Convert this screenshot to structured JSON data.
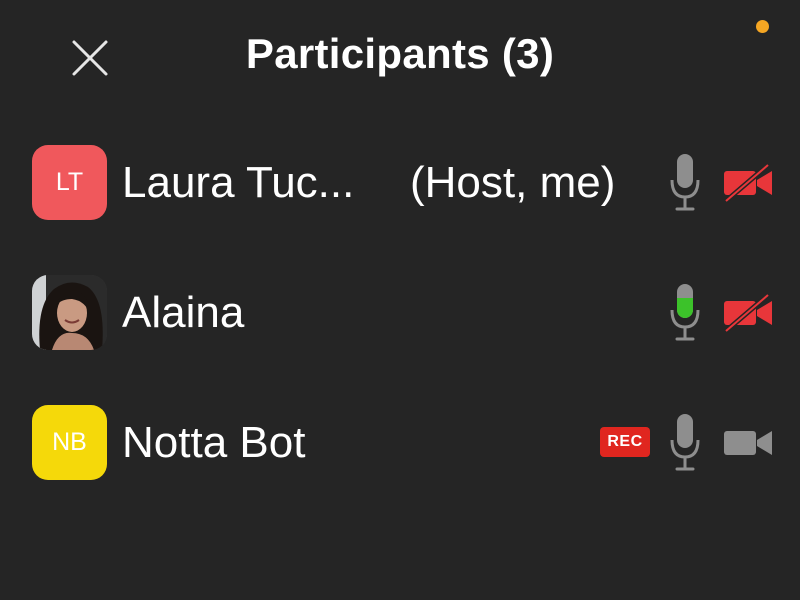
{
  "header": {
    "title": "Participants (3)",
    "close_icon": "close-icon",
    "status_dot_color": "#f5a623"
  },
  "colors": {
    "background": "#252525",
    "icon_gray": "#8e8e8e",
    "muted_red": "#e8363a",
    "speaking_green": "#3cc22a"
  },
  "participants": [
    {
      "initials": "LT",
      "name": "Laura Tuc...",
      "role": "(Host, me)",
      "avatar_color": "#f0585c",
      "mic": "mic-icon",
      "mic_state": "idle",
      "camera": "video-off-icon",
      "camera_state": "off"
    },
    {
      "initials": "",
      "name": "Alaina",
      "role": "",
      "avatar_type": "photo",
      "mic": "mic-speaking-icon",
      "mic_state": "speaking",
      "camera": "video-off-icon",
      "camera_state": "off"
    },
    {
      "initials": "NB",
      "name": "Notta Bot",
      "role": "",
      "avatar_color": "#f5d90a",
      "badge": "REC",
      "badge_color": "#e0261f",
      "mic": "mic-icon",
      "mic_state": "idle",
      "camera": "video-icon",
      "camera_state": "on"
    }
  ]
}
